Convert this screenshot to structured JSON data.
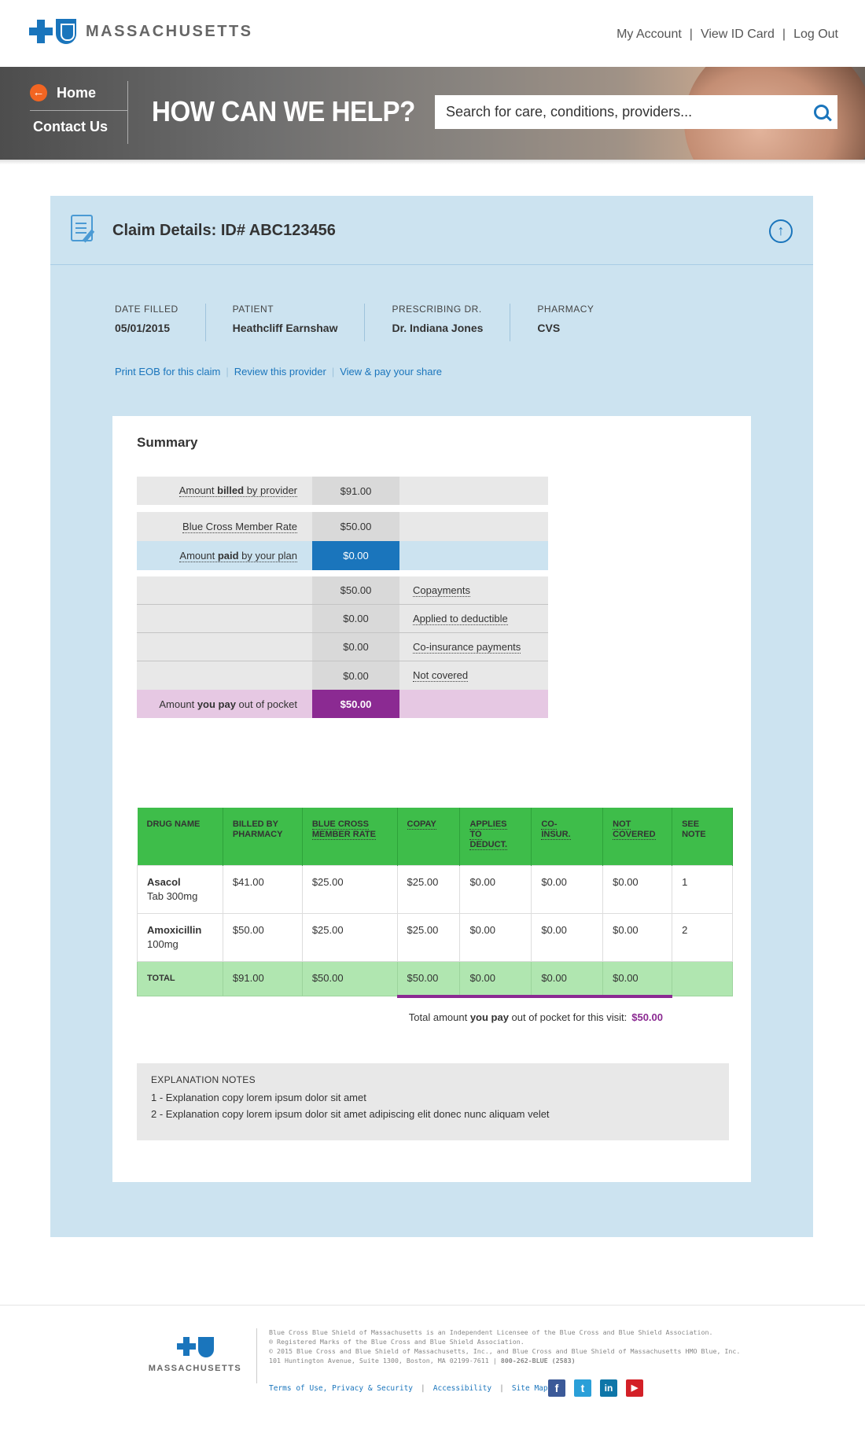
{
  "header": {
    "logo_text": "MASSACHUSETTS",
    "links": [
      "My Account",
      "View ID Card",
      "Log Out"
    ],
    "separator": "|"
  },
  "hero": {
    "nav_home": "Home",
    "nav_contact": "Contact Us",
    "title": "HOW CAN WE HELP?",
    "search_placeholder": "Search for care, conditions, providers..."
  },
  "claim": {
    "title": "Claim Details: ID# ABC123456",
    "meta": [
      {
        "label": "DATE FILLED",
        "value": "05/01/2015"
      },
      {
        "label": "PATIENT",
        "value": "Heathcliff Earnshaw"
      },
      {
        "label": "PRESCRIBING DR.",
        "value": "Dr. Indiana Jones"
      },
      {
        "label": "PHARMACY",
        "value": "CVS"
      }
    ],
    "links": [
      "Print EOB for this claim",
      "Review this provider",
      "View & pay your share"
    ]
  },
  "summary": {
    "title": "Summary",
    "billed": {
      "pre": "Amount ",
      "bold": "billed",
      "post": " by provider",
      "value": "$91.00"
    },
    "member_rate": {
      "label": "Blue Cross Member Rate",
      "value": "$50.00"
    },
    "paid": {
      "pre": "Amount ",
      "bold": "paid",
      "post": " by your plan",
      "value": "$0.00"
    },
    "breakdown": [
      {
        "value": "$50.00",
        "label": "Copayments"
      },
      {
        "value": "$0.00",
        "label": "Applied to deductible"
      },
      {
        "value": "$0.00",
        "label": "Co-insurance payments"
      },
      {
        "value": "$0.00",
        "label": "Not covered"
      }
    ],
    "you_pay": {
      "pre": "Amount ",
      "bold": "you pay",
      "post": " out of pocket",
      "value": "$50.00"
    }
  },
  "drug_table": {
    "headers": [
      {
        "line1": "DRUG NAME",
        "line2": "",
        "line3": ""
      },
      {
        "line1": "BILLED BY",
        "line2": "PHARMACY",
        "line3": ""
      },
      {
        "line1": "BLUE CROSS",
        "line2": "MEMBER RATE",
        "line3": ""
      },
      {
        "line1": "COPAY",
        "line2": "",
        "line3": ""
      },
      {
        "line1": "APPLIES",
        "line2": "TO",
        "line3": "DEDUCT."
      },
      {
        "line1": "CO-",
        "line2": "INSUR.",
        "line3": ""
      },
      {
        "line1": "NOT",
        "line2": "COVERED",
        "line3": ""
      },
      {
        "line1": "SEE",
        "line2": "NOTE",
        "line3": ""
      }
    ],
    "rows": [
      {
        "name": "Asacol",
        "detail": "Tab 300mg",
        "billed": "$41.00",
        "rate": "$25.00",
        "copay": "$25.00",
        "deduct": "$0.00",
        "coins": "$0.00",
        "notcov": "$0.00",
        "note": "1"
      },
      {
        "name": "Amoxicillin",
        "detail": "100mg",
        "billed": "$50.00",
        "rate": "$25.00",
        "copay": "$25.00",
        "deduct": "$0.00",
        "coins": "$0.00",
        "notcov": "$0.00",
        "note": "2"
      }
    ],
    "total": {
      "label": "TOTAL",
      "billed": "$91.00",
      "rate": "$50.00",
      "copay": "$50.00",
      "deduct": "$0.00",
      "coins": "$0.00",
      "notcov": "$0.00"
    }
  },
  "total_line": {
    "pre": "Total amount ",
    "bold": "you pay",
    "post": " out of pocket for this visit:",
    "value": "$50.00"
  },
  "notes": {
    "title": "EXPLANATION NOTES",
    "items": [
      "1 - Explanation copy lorem ipsum dolor sit amet",
      "2 - Explanation copy lorem ipsum dolor sit amet adipiscing elit donec nunc aliquam velet"
    ]
  },
  "footer": {
    "logo_text": "MASSACHUSETTS",
    "lines": [
      "Blue Cross Blue Shield of Massachusetts is an Independent Licensee of the Blue Cross and Blue Shield Association.",
      "® Registered Marks of the Blue Cross and Blue Shield Association.",
      "© 2015 Blue Cross and Blue Shield of Massachusetts, Inc., and Blue Cross and Blue Shield of Massachusetts HMO Blue, Inc.",
      "101 Huntington Avenue, Suite 1300, Boston, MA 02199-7611 |"
    ],
    "phone": "800-262-BLUE (2583)",
    "links": [
      "Terms of Use, Privacy & Security",
      "Accessibility",
      "Site Map"
    ],
    "social": [
      {
        "name": "facebook-icon",
        "glyph": "f",
        "color": "#3b5998"
      },
      {
        "name": "twitter-icon",
        "glyph": "t",
        "color": "#2a9fd8"
      },
      {
        "name": "linkedin-icon",
        "glyph": "in",
        "color": "#0e76a8"
      },
      {
        "name": "youtube-icon",
        "glyph": "▶",
        "color": "#d32027"
      }
    ]
  },
  "colors": {
    "brand_blue": "#1a75bc",
    "purple": "#8b2a92",
    "green": "#3ebd4a",
    "orange": "#f26522"
  }
}
